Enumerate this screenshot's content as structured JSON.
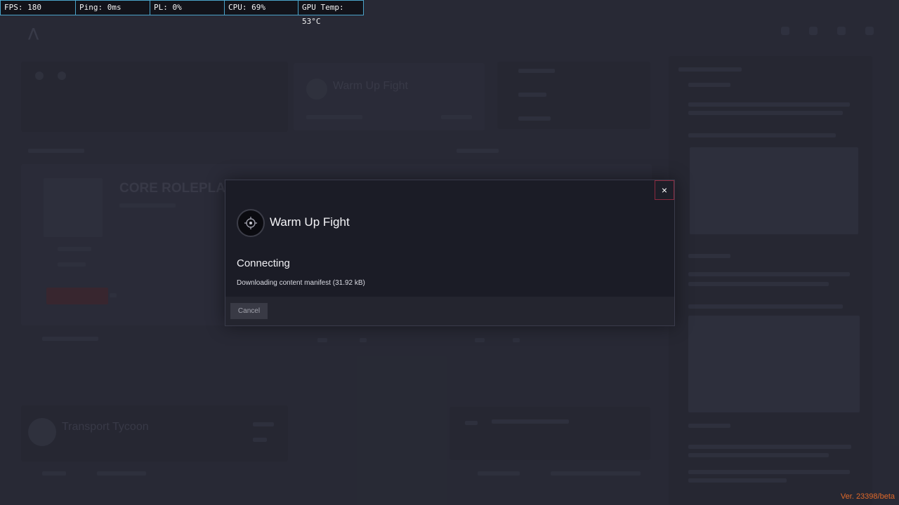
{
  "perf_overlay": {
    "fps": "FPS: 180",
    "ping": "Ping: 0ms",
    "pl": "PL: 0%",
    "cpu": "CPU: 69%",
    "gpu_temp": "GPU Temp: 53°C"
  },
  "background": {
    "nav_items": [
      "",
      "",
      "",
      ""
    ],
    "featured_server": "Warm Up Fight",
    "selected_server": "CORE ROLEPLAY",
    "bottom_server": "Transport Tycoon"
  },
  "modal": {
    "server_name": "Warm Up Fight",
    "status_title": "Connecting",
    "status_detail": "Downloading content manifest (31.92 kB)",
    "cancel_label": "Cancel",
    "close_glyph": "×",
    "server_icon": "crosshair-icon"
  },
  "footer": {
    "version": "Ver. 23398/beta"
  },
  "colors": {
    "accent_red": "#8a2a3f",
    "version_orange": "#e0692a",
    "perf_border": "#4aa3c9"
  }
}
